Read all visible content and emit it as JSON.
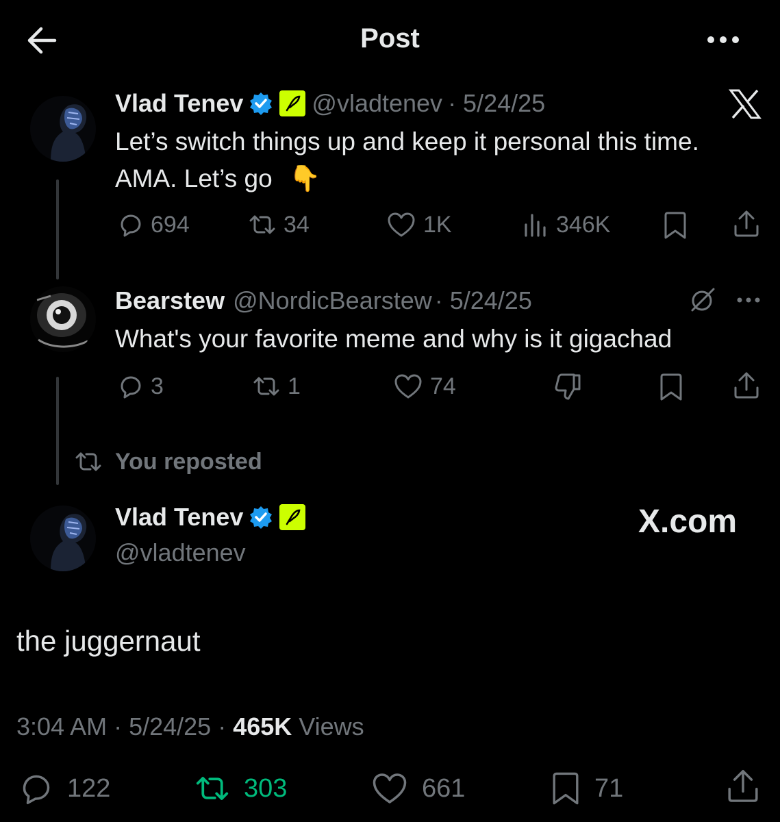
{
  "header": {
    "title": "Post"
  },
  "quoted": {
    "name": "Vlad Tenev",
    "handle": "@vladtenev",
    "date": "· 5/24/25",
    "text": "Let’s switch things up and keep it personal this time. AMA. Let’s go",
    "emoji": "👇",
    "replies": "694",
    "reposts": "34",
    "likes": "1K",
    "views": "346K"
  },
  "reply": {
    "name": "Bearstew",
    "handle": "@NordicBearstew",
    "date": "· 5/24/25",
    "text": "What's your favorite meme and why is it gigachad",
    "replies": "3",
    "reposts": "1",
    "likes": "74"
  },
  "repost_label": "You reposted",
  "main": {
    "name": "Vlad Tenev",
    "handle": "@vladtenev",
    "watermark": "X.com",
    "text": "the juggernaut",
    "time": "3:04 AM",
    "date": "· 5/24/25 ·",
    "views_count": "465K",
    "views_label": "Views",
    "replies": "122",
    "reposts": "303",
    "likes": "661",
    "bookmarks": "71"
  },
  "colors": {
    "background": "#000000",
    "text": "#e7e9ea",
    "muted": "#71767b",
    "verified": "#1d9bf0",
    "affiliate": "#ccff00",
    "repost_active": "#00ba7c"
  },
  "icons": [
    "back-arrow-icon",
    "more-icon",
    "verified-icon",
    "robinhood-feather-icon",
    "x-logo-icon",
    "reply-icon",
    "repost-icon",
    "like-icon",
    "views-icon",
    "bookmark-icon",
    "share-icon",
    "grok-icon",
    "dislike-icon"
  ]
}
